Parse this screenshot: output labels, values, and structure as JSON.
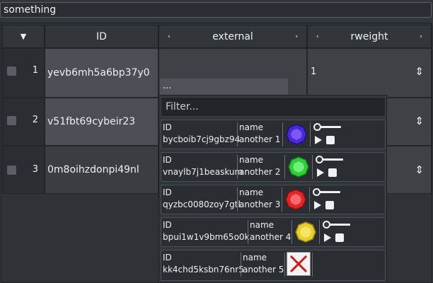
{
  "title": "something",
  "headers": {
    "sort_icon": "▼",
    "id": "ID",
    "external": "external",
    "rweight": "rweight",
    "left_chevron": "‹",
    "right_chevron": "›"
  },
  "rows": [
    {
      "num": "1",
      "id": "yevb6mh5a6bp37y0",
      "rweight": "1"
    },
    {
      "num": "2",
      "id": "v51fbt69cybeir23",
      "rweight": ""
    },
    {
      "num": "3",
      "id": "0m8oihzdonpi49nl",
      "rweight": ""
    }
  ],
  "updown_glyph": "⇕",
  "external_value": "...",
  "popup": {
    "filter_placeholder": "Filter...",
    "items": [
      {
        "id_label": "ID",
        "id": "bycboib7cj9gbz94",
        "name_label": "name",
        "name": "another 1",
        "gem": "purple-gem-icon",
        "color": "#4a2ad6",
        "has_player": true
      },
      {
        "id_label": "ID",
        "id": "vnaylb7j1beaskum",
        "name_label": "name",
        "name": "another 2",
        "gem": "green-gem-icon",
        "color": "#2fcf3a",
        "has_player": true
      },
      {
        "id_label": "ID",
        "id": "qyzbc0080zoy7gtl",
        "name_label": "name",
        "name": "another 3",
        "gem": "red-gem-icon",
        "color": "#e02727",
        "has_player": true
      },
      {
        "id_label": "ID",
        "id": "bpui1w1v9bm65o0k",
        "name_label": "name",
        "name": "another 4",
        "gem": "yellow-gem-icon",
        "color": "#e6cf2a",
        "has_player": true
      },
      {
        "id_label": "ID",
        "id": "kk4chd5ksbn76nr5",
        "name_label": "name",
        "name": "another 5",
        "gem": "broken-image-icon",
        "color": "#cc1a1a",
        "has_player": false
      }
    ]
  }
}
